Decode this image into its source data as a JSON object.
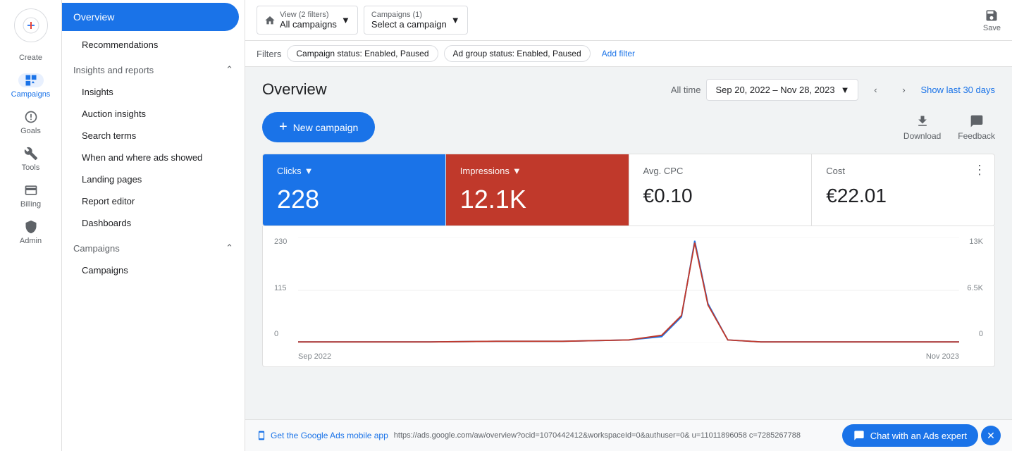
{
  "sidebar_icons": {
    "create_label": "Create",
    "campaigns_label": "Campaigns",
    "goals_label": "Goals",
    "tools_label": "Tools",
    "billing_label": "Billing",
    "admin_label": "Admin"
  },
  "nav": {
    "overview_label": "Overview",
    "recommendations_label": "Recommendations",
    "insights_reports_label": "Insights and reports",
    "insights_label": "Insights",
    "auction_insights_label": "Auction insights",
    "search_terms_label": "Search terms",
    "when_where_label": "When and where ads showed",
    "landing_pages_label": "Landing pages",
    "report_editor_label": "Report editor",
    "dashboards_label": "Dashboards",
    "campaigns_section_label": "Campaigns",
    "campaigns_item_label": "Campaigns"
  },
  "topbar": {
    "view_label": "View (2 filters)",
    "all_campaigns_value": "All campaigns",
    "campaigns_label": "Campaigns (1)",
    "select_campaign_value": "Select a campaign",
    "save_label": "Save"
  },
  "filters": {
    "filter_label": "Filters",
    "campaign_status_chip": "Campaign status: Enabled, Paused",
    "ad_group_chip": "Ad group status: Enabled, Paused",
    "add_filter_label": "Add filter"
  },
  "overview": {
    "title": "Overview",
    "all_time_label": "All time",
    "date_range": "Sep 20, 2022 – Nov 28, 2023",
    "show_last_30": "Show last 30 days",
    "new_campaign_label": "New campaign",
    "download_label": "Download",
    "feedback_label": "Feedback"
  },
  "stats": {
    "clicks_label": "Clicks",
    "clicks_value": "228",
    "impressions_label": "Impressions",
    "impressions_value": "12.1K",
    "avg_cpc_label": "Avg. CPC",
    "avg_cpc_value": "€0.10",
    "cost_label": "Cost",
    "cost_value": "€22.01"
  },
  "chart": {
    "y_left_top": "230",
    "y_left_mid": "115",
    "y_left_bottom": "0",
    "y_right_top": "13K",
    "y_right_mid": "6.5K",
    "y_right_bottom": "0",
    "x_left": "Sep 2022",
    "x_right": "Nov 2023",
    "colors": {
      "blue_line": "#1a73e8",
      "red_line": "#c0392b"
    }
  },
  "bottom": {
    "link_label": "Get the Google Ads mobile app",
    "url": "https://ads.google.com/aw/overview?ocid=1070442412&workspaceId=0&authuser=0&   u=11011896058   c=7285267788",
    "chat_label": "Chat with an Ads expert"
  }
}
